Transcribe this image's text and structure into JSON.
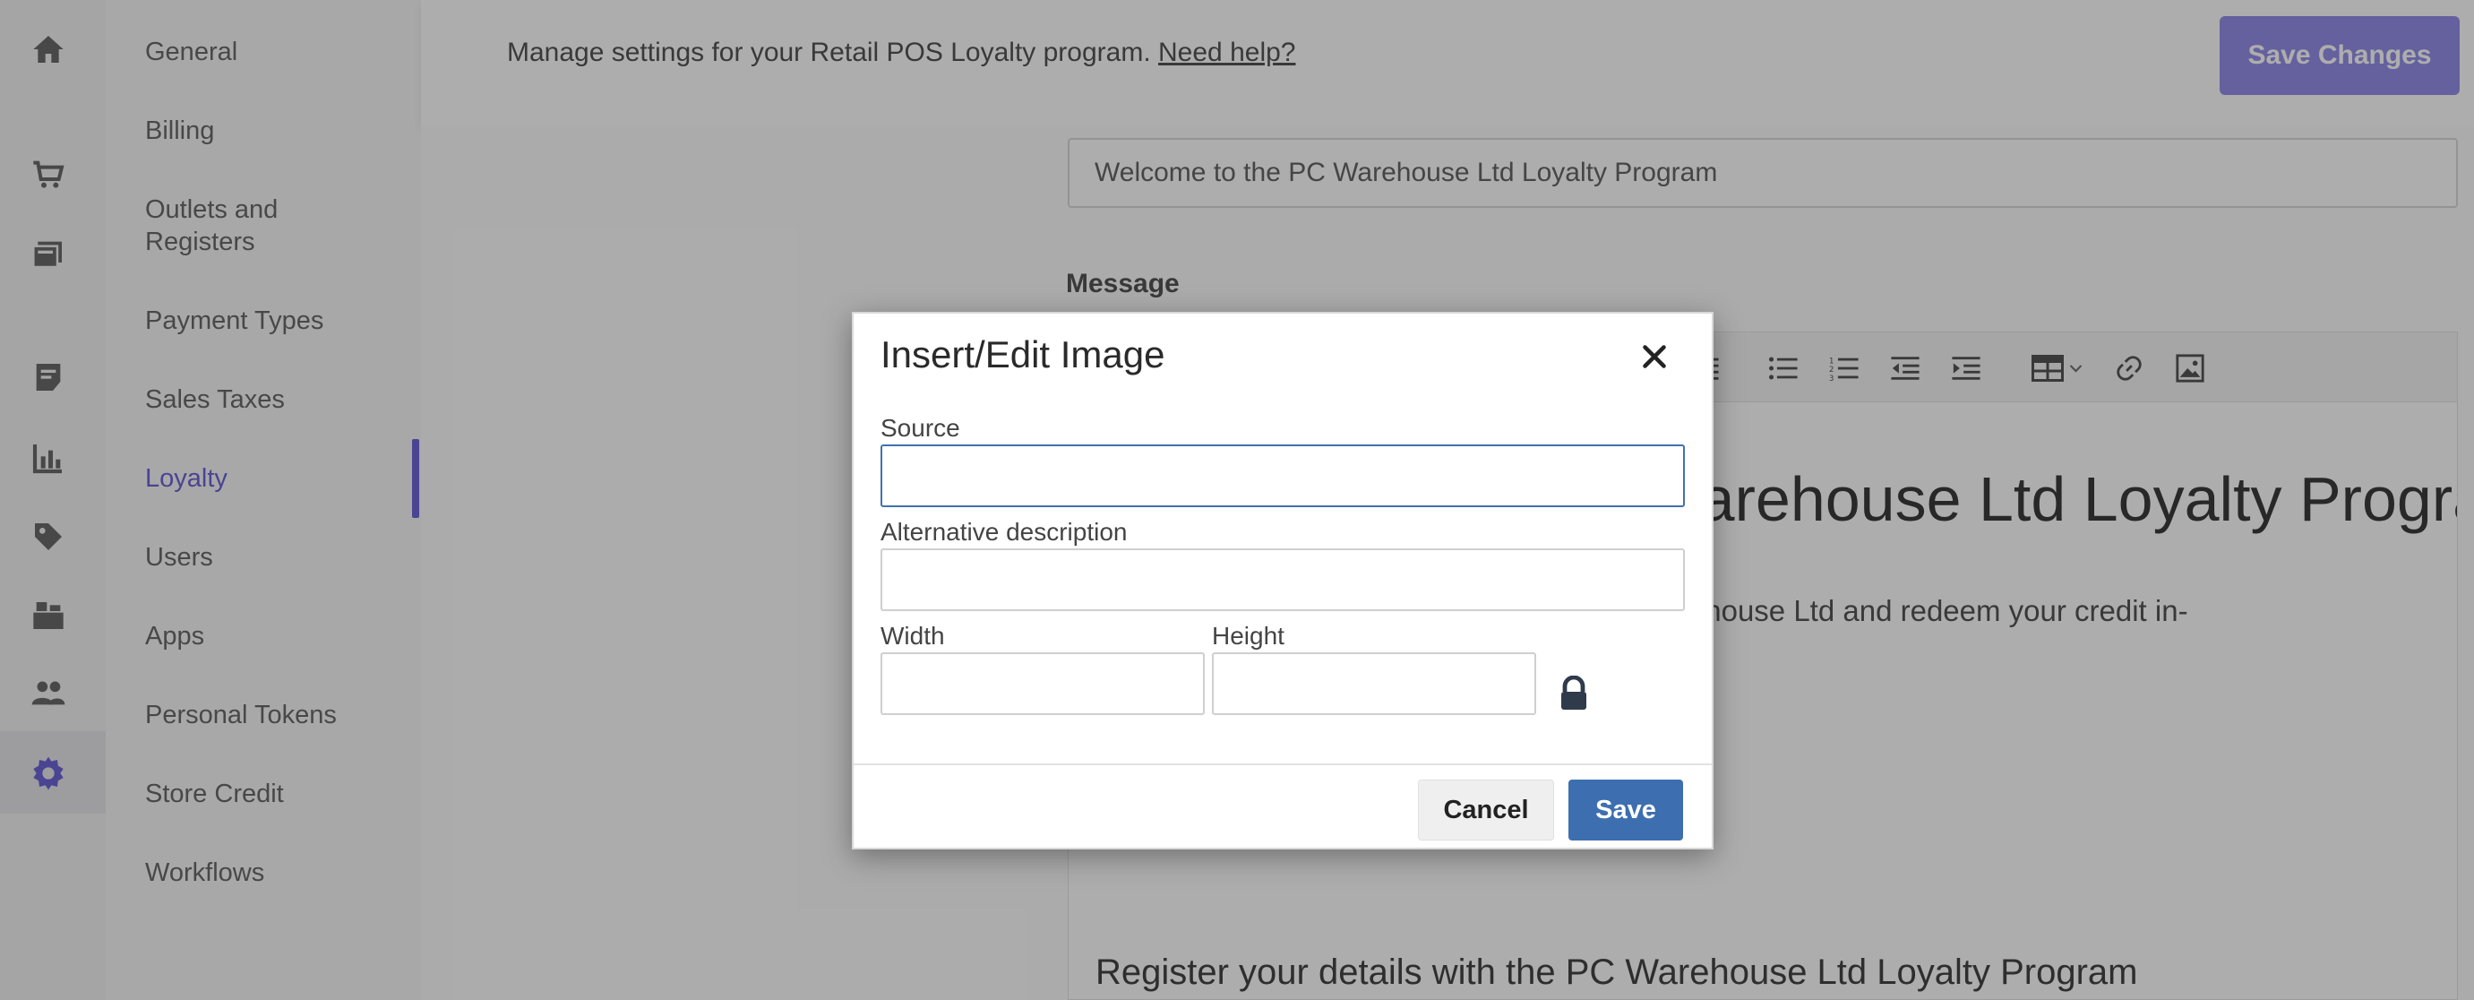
{
  "sidebar": {
    "items": [
      {
        "label": "General"
      },
      {
        "label": "Billing"
      },
      {
        "label": "Outlets and Registers"
      },
      {
        "label": "Payment Types"
      },
      {
        "label": "Sales Taxes"
      },
      {
        "label": "Loyalty",
        "active": true
      },
      {
        "label": "Users"
      },
      {
        "label": "Apps"
      },
      {
        "label": "Personal Tokens"
      },
      {
        "label": "Store Credit"
      },
      {
        "label": "Workflows"
      }
    ],
    "rail_icons": [
      "home-icon",
      "cart-icon",
      "catalog-icon",
      "receipt-icon",
      "reports-icon",
      "tag-icon",
      "inventory-icon",
      "customers-icon",
      "settings-icon"
    ]
  },
  "header": {
    "description": "Manage settings for your Retail POS Loyalty program.",
    "help_link": "Need help?",
    "save_button": "Save Changes"
  },
  "main": {
    "subject_value": "Welcome to the PC Warehouse Ltd Loyalty Program",
    "message_label": "Message",
    "editor": {
      "heading": "Welcome to the PC Warehouse Ltd Loyalty Program",
      "paragraph": "Earn loyalty credit on all purchases at PC Warehouse Ltd and redeem your credit in-",
      "subheading": "Register your details with the PC Warehouse Ltd Loyalty Program"
    },
    "toolbar_icons": [
      "align-justify-icon",
      "bullet-list-icon",
      "numbered-list-icon",
      "outdent-icon",
      "indent-icon",
      "table-icon",
      "link-icon",
      "image-icon"
    ]
  },
  "dialog": {
    "title": "Insert/Edit Image",
    "source_label": "Source",
    "source_value": "",
    "alt_label": "Alternative description",
    "alt_value": "",
    "width_label": "Width",
    "width_value": "",
    "height_label": "Height",
    "height_value": "",
    "cancel_label": "Cancel",
    "save_label": "Save"
  },
  "colors": {
    "accent": "#6e65d8",
    "save_changes_bg": "#9690ea",
    "dialog_primary": "#3d6fb0"
  }
}
